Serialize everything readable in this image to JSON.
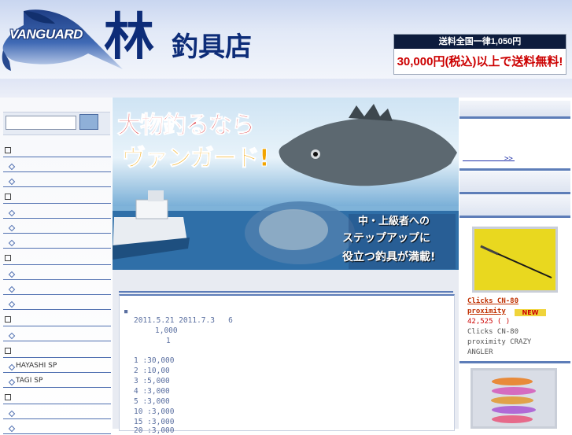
{
  "header": {
    "logo_text": "VANGUARD",
    "store_name_big": "林",
    "store_name_rest": "釣具店",
    "promo_top": "送料全国一律1,050円",
    "promo_bottom": "30,000円(税込)以上で送料無料!"
  },
  "search": {
    "placeholder": ""
  },
  "sidebar": {
    "groups": [
      {
        "items": [
          "",
          ""
        ]
      },
      {
        "items": [
          "",
          "",
          ""
        ]
      },
      {
        "items": [
          "",
          "",
          ""
        ]
      },
      {
        "items": [
          ""
        ]
      },
      {
        "items": [
          "HAYASHI SP",
          "TAGI SP"
        ]
      },
      {
        "items": [
          "",
          ""
        ]
      }
    ]
  },
  "banner": {
    "headline_1": "大物釣るなら",
    "headline_2": "ヴァンガード!",
    "sub_1": "中・上級者への",
    "sub_2": "ステップアップに",
    "sub_3": "役立つ釣具が満載!"
  },
  "content": {
    "bullet": "■",
    "line1": "2011.5.21 2011.7.3   6",
    "line2": "1,000",
    "line3": "1",
    "prizes": [
      "1 :30,000",
      "2 :10,00",
      "3 :5,000",
      "4 :3,000",
      "5 :3,000",
      "10 :3,000",
      "15 :3,000",
      "20 :3,000"
    ]
  },
  "right": {
    "link_more": ">>",
    "product1": {
      "name_1": "Clicks CN-80",
      "name_2": "proximity",
      "badge": "NEW",
      "price": "42,525 (  )",
      "desc_1": "Clicks CN-80",
      "desc_2": "proximity CRAZY",
      "desc_3": "ANGLER"
    }
  },
  "colors": {
    "accent_blue": "#4f6fb0",
    "link_color": "#2233aa",
    "product_name": "#c03000",
    "price_red": "#cc0000",
    "header_navy": "#0d2c78"
  }
}
